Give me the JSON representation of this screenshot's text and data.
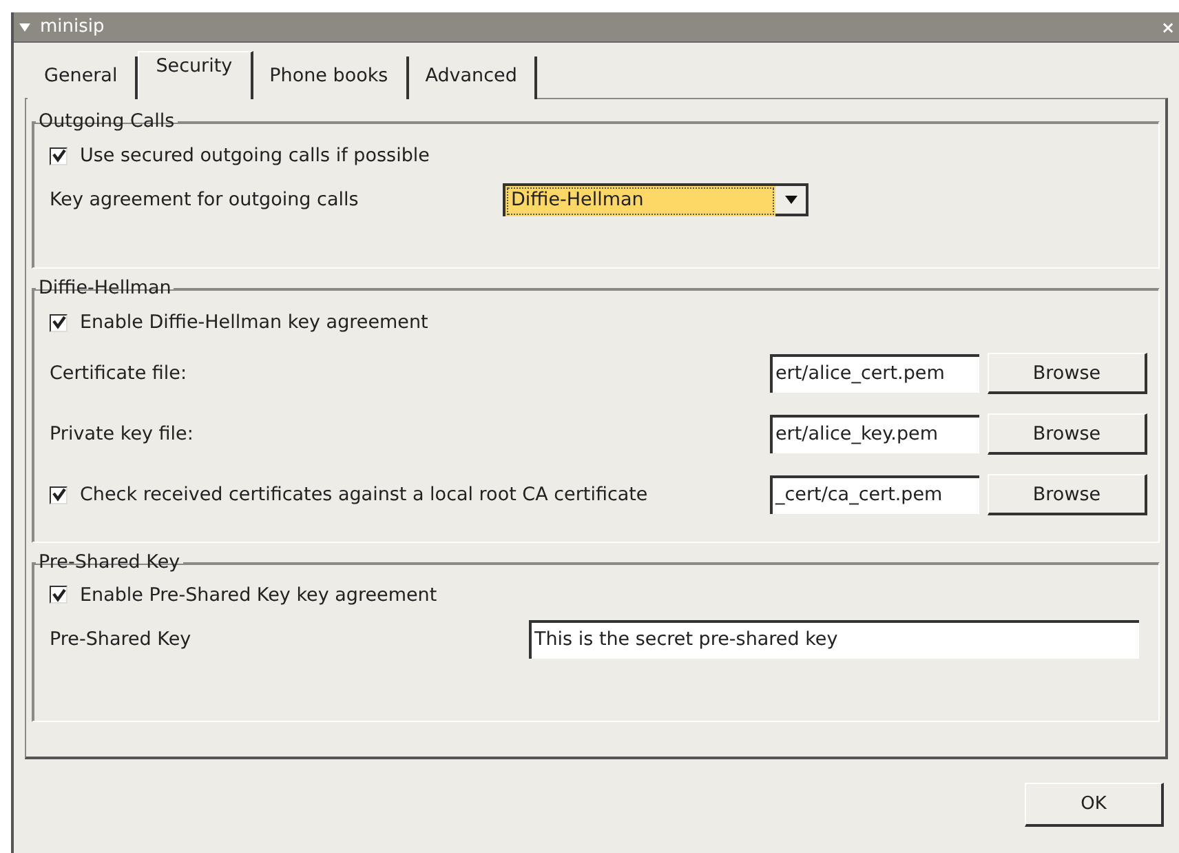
{
  "window": {
    "title": "minisip",
    "close": "×"
  },
  "tabs": [
    {
      "label": "General",
      "selected": false
    },
    {
      "label": "Security",
      "selected": true
    },
    {
      "label": "Phone books",
      "selected": false
    },
    {
      "label": "Advanced",
      "selected": false
    }
  ],
  "groups": [
    {
      "title": "Outgoing Calls",
      "rows": [
        {
          "kind": "checkbox",
          "label": "Use secured outgoing calls if possible",
          "checked": true
        },
        {
          "kind": "select",
          "label": "Key agreement for outgoing calls",
          "value": "Diffie-Hellman",
          "focused": true
        }
      ]
    },
    {
      "title": "Diffie-Hellman",
      "rows": [
        {
          "kind": "checkbox",
          "label": "Enable Diffie-Hellman key agreement",
          "checked": true
        },
        {
          "kind": "file",
          "label": "Certificate file:",
          "value": "ert/alice_cert.pem",
          "button": "Browse"
        },
        {
          "kind": "file",
          "label": "Private key file:",
          "value": "ert/alice_key.pem",
          "button": "Browse"
        },
        {
          "kind": "checkbox_file",
          "label": "Check received certificates against a local root CA certificate",
          "checked": true,
          "value": "_cert/ca_cert.pem",
          "button": "Browse"
        }
      ]
    },
    {
      "title": "Pre-Shared Key",
      "rows": [
        {
          "kind": "checkbox",
          "label": "Enable Pre-Shared Key key agreement",
          "checked": true
        },
        {
          "kind": "text",
          "label": "Pre-Shared Key",
          "value": "This is the secret pre-shared key"
        }
      ]
    }
  ],
  "buttons": [
    "OK"
  ]
}
